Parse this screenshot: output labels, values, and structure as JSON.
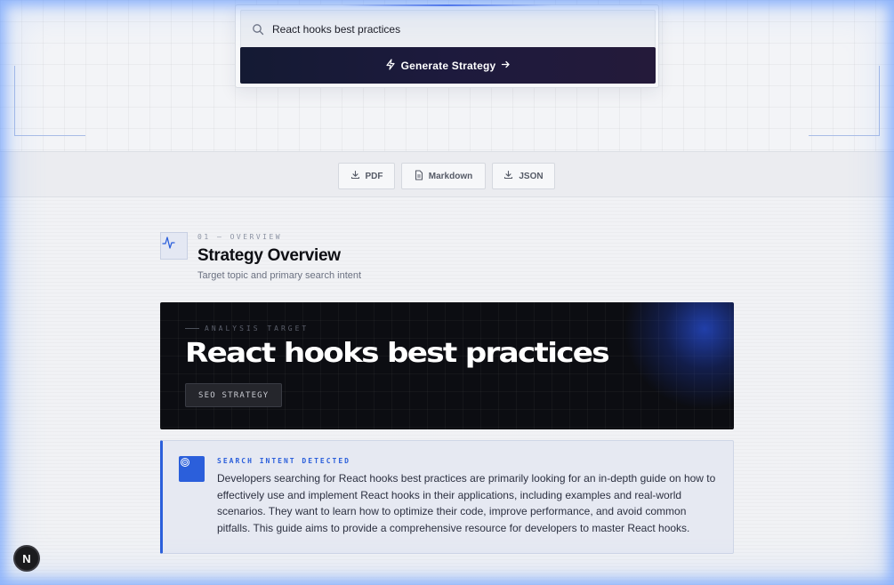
{
  "search": {
    "value": "React hooks best practices",
    "button_label": "Generate Strategy"
  },
  "export": {
    "pdf_label": "PDF",
    "markdown_label": "Markdown",
    "json_label": "JSON"
  },
  "section": {
    "eyebrow": "01 — OVERVIEW",
    "title": "Strategy Overview",
    "subtitle": "Target topic and primary search intent"
  },
  "hero": {
    "eyebrow": "ANALYSIS TARGET",
    "title": "React hooks best practices",
    "badge": "SEO STRATEGY"
  },
  "intent": {
    "label": "SEARCH INTENT DETECTED",
    "text": "Developers searching for React hooks best practices are primarily looking for an in-depth guide on how to effectively use and implement React hooks in their applications, including examples and real-world scenarios. They want to learn how to optimize their code, improve performance, and avoid common pitfalls. This guide aims to provide a comprehensive resource for developers to master React hooks."
  },
  "avatar": {
    "initial": "N"
  },
  "colors": {
    "accent": "#2b5fdb",
    "hero_bg": "#0c0d12",
    "button_bg": "#141a33"
  },
  "icons": {
    "search": "search-icon",
    "generate": "lightning-icon",
    "arrow": "arrow-right-icon",
    "pdf": "download-icon",
    "markdown": "document-icon",
    "json": "download-icon",
    "section": "pulse-icon",
    "intent": "target-icon"
  }
}
